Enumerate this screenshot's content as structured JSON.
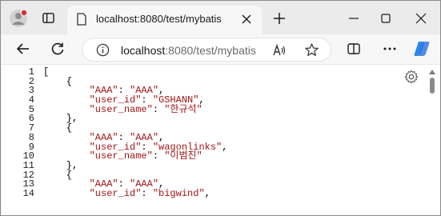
{
  "tab": {
    "title": "localhost:8080/test/mybatis",
    "favicon": "page-icon"
  },
  "address_bar": {
    "host": "localhost",
    "path": ":8080/test/mybatis"
  },
  "icons": {
    "profile": "profile-avatar-icon",
    "tab_actions": "tab-actions-icon",
    "close_tab": "close-icon",
    "new_tab": "plus-icon",
    "minimize": "minimize-icon",
    "maximize": "maximize-icon",
    "close_window": "close-icon",
    "back": "arrow-left-icon",
    "reload": "reload-icon",
    "site_info": "info-icon",
    "read_aloud": "read-aloud-icon",
    "favorite": "star-icon",
    "split_screen": "split-screen-icon",
    "more": "more-icon",
    "copilot": "copilot-icon",
    "settings": "gear-icon"
  },
  "colors": {
    "string": "#a31515",
    "profile_badge": "#d13438"
  },
  "code": {
    "lines": [
      {
        "n": "1",
        "parts": [
          [
            "p",
            "["
          ]
        ]
      },
      {
        "n": "2",
        "parts": [
          [
            "p",
            "    {"
          ]
        ]
      },
      {
        "n": "3",
        "parts": [
          [
            "p",
            "        "
          ],
          [
            "s",
            "\"AAA\""
          ],
          [
            "p",
            ": "
          ],
          [
            "s",
            "\"AAA\""
          ],
          [
            "p",
            ","
          ]
        ]
      },
      {
        "n": "4",
        "parts": [
          [
            "p",
            "        "
          ],
          [
            "s",
            "\"user_id\""
          ],
          [
            "p",
            ": "
          ],
          [
            "s",
            "\"GSHANN\""
          ],
          [
            "p",
            ","
          ]
        ]
      },
      {
        "n": "5",
        "parts": [
          [
            "p",
            "        "
          ],
          [
            "s",
            "\"user_name\""
          ],
          [
            "p",
            ": "
          ],
          [
            "s",
            "\"한규석\""
          ]
        ]
      },
      {
        "n": "6",
        "parts": [
          [
            "p",
            "    },"
          ]
        ]
      },
      {
        "n": "7",
        "parts": [
          [
            "p",
            "    {"
          ]
        ]
      },
      {
        "n": "8",
        "parts": [
          [
            "p",
            "        "
          ],
          [
            "s",
            "\"AAA\""
          ],
          [
            "p",
            ": "
          ],
          [
            "s",
            "\"AAA\""
          ],
          [
            "p",
            ","
          ]
        ]
      },
      {
        "n": "9",
        "parts": [
          [
            "p",
            "        "
          ],
          [
            "s",
            "\"user_id\""
          ],
          [
            "p",
            ": "
          ],
          [
            "s",
            "\"wagonlinks\""
          ],
          [
            "p",
            ","
          ]
        ]
      },
      {
        "n": "10",
        "parts": [
          [
            "p",
            "        "
          ],
          [
            "s",
            "\"user_name\""
          ],
          [
            "p",
            ": "
          ],
          [
            "s",
            "\"이범진\""
          ]
        ]
      },
      {
        "n": "11",
        "parts": [
          [
            "p",
            "    },"
          ]
        ]
      },
      {
        "n": "12",
        "parts": [
          [
            "p",
            "    {"
          ]
        ]
      },
      {
        "n": "13",
        "parts": [
          [
            "p",
            "        "
          ],
          [
            "s",
            "\"AAA\""
          ],
          [
            "p",
            ": "
          ],
          [
            "s",
            "\"AAA\""
          ],
          [
            "p",
            ","
          ]
        ]
      },
      {
        "n": "14",
        "parts": [
          [
            "p",
            "        "
          ],
          [
            "s",
            "\"user_id\""
          ],
          [
            "p",
            ": "
          ],
          [
            "s",
            "\"bigwind\""
          ],
          [
            "p",
            ","
          ]
        ]
      }
    ]
  }
}
